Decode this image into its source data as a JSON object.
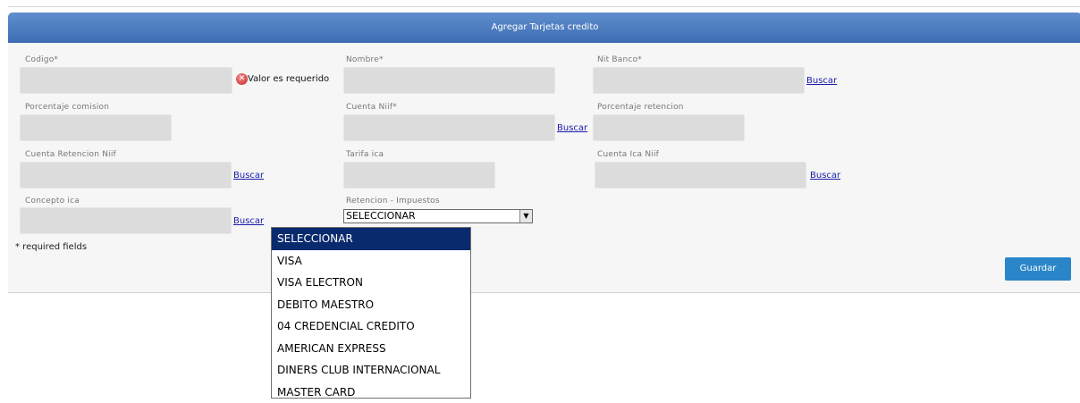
{
  "form": {
    "title": "Agregar Tarjetas credito",
    "required_note": "* required fields",
    "save_label": "Guardar",
    "search_label": "Buscar",
    "error_text": "Valor es requerido",
    "fields": {
      "codigo": {
        "label": "Codigo*",
        "value": ""
      },
      "nombre": {
        "label": "Nombre*",
        "value": ""
      },
      "nit_banco": {
        "label": "Nit Banco*",
        "value": ""
      },
      "porcentaje_comision": {
        "label": "Porcentaje comision",
        "value": ""
      },
      "cuenta_niif": {
        "label": "Cuenta Niif*",
        "value": ""
      },
      "porcentaje_retencion": {
        "label": "Porcentaje retencion",
        "value": ""
      },
      "cuenta_retencion_niif": {
        "label": "Cuenta Retencion Niif",
        "value": ""
      },
      "tarifa_ica": {
        "label": "Tarifa ica",
        "value": ""
      },
      "cuenta_ica_niif": {
        "label": "Cuenta Ica Niif",
        "value": ""
      },
      "concepto_ica": {
        "label": "Concepto ica",
        "value": ""
      },
      "retencion_impuestos": {
        "label": "Retencion - Impuestos",
        "selected": "SELECCIONAR"
      }
    }
  },
  "dropdown": {
    "options": [
      "SELECCIONAR",
      "VISA",
      "VISA ELECTRON",
      "DEBITO MAESTRO",
      "04 CREDENCIAL CREDITO",
      "AMERICAN EXPRESS",
      "DINERS CLUB INTERNACIONAL",
      "MASTER CARD"
    ],
    "highlighted": "SELECCIONAR"
  },
  "colors": {
    "header": "#4a7cc0",
    "save_button": "#2a86c9",
    "highlight": "#0a2a6e"
  }
}
